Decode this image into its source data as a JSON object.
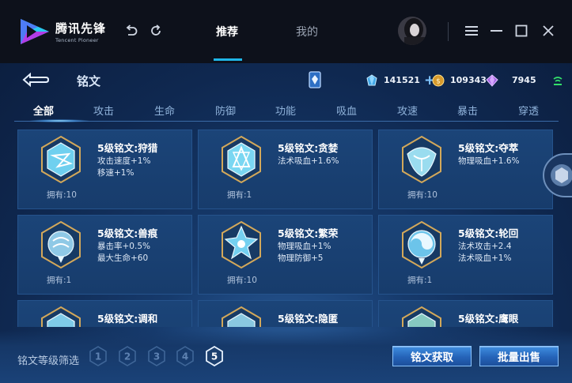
{
  "app": {
    "logo_cn": "腾讯先锋",
    "logo_en": "Tencent Pioneer",
    "nav": [
      "推荐",
      "我的"
    ],
    "active_nav": "推荐"
  },
  "header": {
    "title": "铭文",
    "currencies": [
      {
        "icon": "diamond-icon",
        "value": "141521"
      },
      {
        "icon": "gold-coin-icon",
        "value": "109343"
      },
      {
        "icon": "crystal-icon",
        "value": "7945"
      }
    ]
  },
  "tabs": [
    "全部",
    "攻击",
    "生命",
    "防御",
    "功能",
    "吸血",
    "攻速",
    "暴击",
    "穿透"
  ],
  "cards": [
    {
      "name": "5级铭文:狩猎",
      "attrs": [
        "攻击速度+1%",
        "移速+1%"
      ],
      "own": "拥有:10",
      "color": "#6fd0ef"
    },
    {
      "name": "5级铭文:贪婪",
      "attrs": [
        "法术吸血+1.6%"
      ],
      "own": "拥有:1",
      "color": "#7ad7f2"
    },
    {
      "name": "5级铭文:夺萃",
      "attrs": [
        "物理吸血+1.6%"
      ],
      "own": "拥有:10",
      "color": "#9adcef"
    },
    {
      "name": "5级铭文:兽痕",
      "attrs": [
        "暴击率+0.5%",
        "最大生命+60"
      ],
      "own": "拥有:1",
      "color": "#8fc9e6"
    },
    {
      "name": "5级铭文:繁荣",
      "attrs": [
        "物理吸血+1%",
        "物理防御+5"
      ],
      "own": "拥有:10",
      "color": "#74d0f0"
    },
    {
      "name": "5级铭文:轮回",
      "attrs": [
        "法术攻击+2.4",
        "法术吸血+1%"
      ],
      "own": "拥有:1",
      "color": "#6cc4ea"
    },
    {
      "name": "5级铭文:调和",
      "attrs": [],
      "own": "",
      "color": "#7fcbe8"
    },
    {
      "name": "5级铭文:隐匿",
      "attrs": [],
      "own": "",
      "color": "#8ac8e0"
    },
    {
      "name": "5级铭文:鹰眼",
      "attrs": [],
      "own": "",
      "color": "#86c9c0"
    }
  ],
  "footer": {
    "filter_label": "铭文等级筛选",
    "levels": [
      "1",
      "2",
      "3",
      "4",
      "5"
    ],
    "selected_level": "5",
    "get_button": "铭文获取",
    "sell_button": "批量出售"
  }
}
